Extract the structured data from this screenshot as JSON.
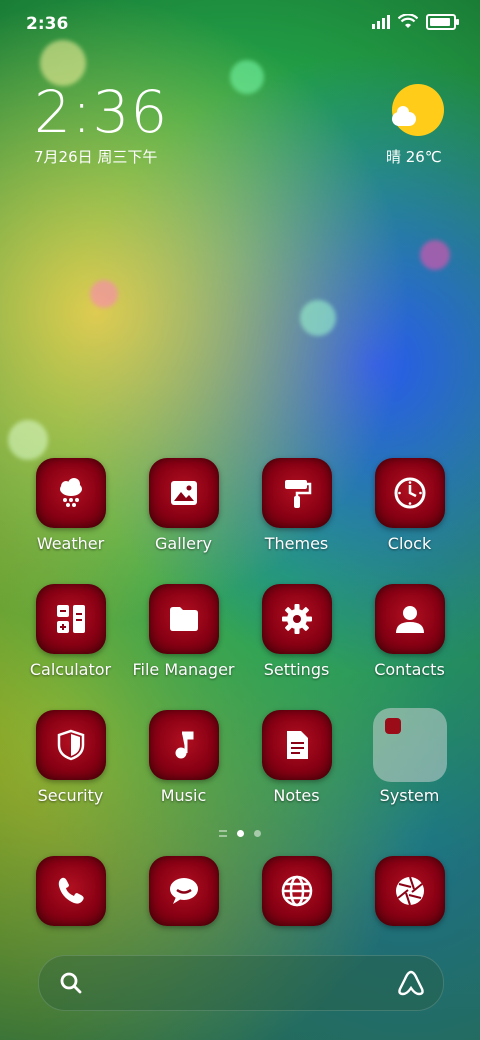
{
  "status_bar": {
    "time": "2:36",
    "battery_level": 0.9
  },
  "clock_widget": {
    "time": "2:36",
    "date": "7月26日 周三下午"
  },
  "weather_widget": {
    "text": "晴 26℃"
  },
  "apps": [
    {
      "label": "Weather",
      "icon": "cloud-snow-icon"
    },
    {
      "label": "Gallery",
      "icon": "image-icon"
    },
    {
      "label": "Themes",
      "icon": "paint-roller-icon"
    },
    {
      "label": "Clock",
      "icon": "clock-icon"
    },
    {
      "label": "Calculator",
      "icon": "calculator-icon"
    },
    {
      "label": "File Manager",
      "icon": "folder-icon"
    },
    {
      "label": "Settings",
      "icon": "gear-icon"
    },
    {
      "label": "Contacts",
      "icon": "person-icon"
    },
    {
      "label": "Security",
      "icon": "shield-icon"
    },
    {
      "label": "Music",
      "icon": "music-note-icon"
    },
    {
      "label": "Notes",
      "icon": "note-icon"
    },
    {
      "label": "System",
      "icon": "folder-icon"
    }
  ],
  "dock": [
    {
      "icon": "phone-icon"
    },
    {
      "icon": "message-icon"
    },
    {
      "icon": "globe-icon"
    },
    {
      "icon": "camera-aperture-icon"
    }
  ],
  "page_indicator": {
    "pages": 2,
    "current": 1
  },
  "colors": {
    "icon_red": "#8a0014",
    "sun": "#ffcc1a"
  }
}
